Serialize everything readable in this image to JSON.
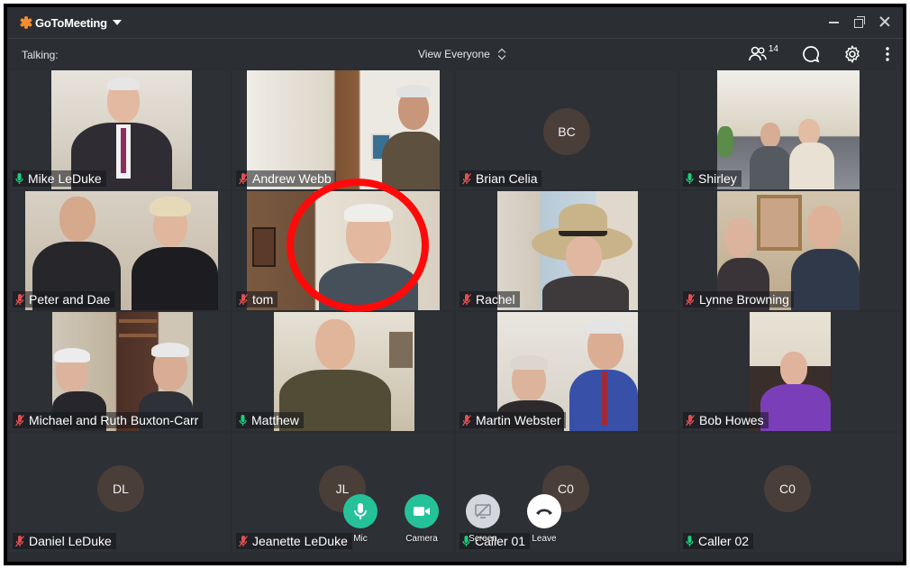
{
  "app": {
    "title_bold": "GoToMeeting",
    "brand_color": "#f68d2e"
  },
  "toolbar": {
    "talking_label": "Talking:",
    "view_label": "View Everyone",
    "attendee_count": "14"
  },
  "tiles": [
    {
      "name": "Mike LeDuke",
      "mic": "on"
    },
    {
      "name": "Andrew Webb",
      "mic": "muted"
    },
    {
      "name": "Brian  Celia",
      "mic": "muted",
      "initials": "BC"
    },
    {
      "name": "Shirley",
      "mic": "on"
    },
    {
      "name": "Peter and Dae",
      "mic": "muted"
    },
    {
      "name": "tom",
      "mic": "muted"
    },
    {
      "name": "Rachel",
      "mic": "muted"
    },
    {
      "name": "Lynne Browning",
      "mic": "muted"
    },
    {
      "name": "Michael and Ruth Buxton-Carr",
      "mic": "muted"
    },
    {
      "name": "Matthew",
      "mic": "on"
    },
    {
      "name": "Martin Webster",
      "mic": "muted"
    },
    {
      "name": "Bob Howes",
      "mic": "muted"
    },
    {
      "name": "Daniel LeDuke",
      "mic": "muted",
      "initials": "DL"
    },
    {
      "name": "Jeanette LeDuke",
      "mic": "muted",
      "initials": "JL"
    },
    {
      "name": "Caller 01",
      "mic": "on",
      "initials": "C0"
    },
    {
      "name": "Caller 02",
      "mic": "on",
      "initials": "C0"
    }
  ],
  "controls": {
    "mic": "Mic",
    "camera": "Camera",
    "screen": "Screen",
    "leave": "Leave"
  },
  "colors": {
    "mic_on": "#19d07a",
    "mic_muted": "#e05050",
    "accent_green": "#25c29a",
    "highlight": "#ff0a0a"
  }
}
